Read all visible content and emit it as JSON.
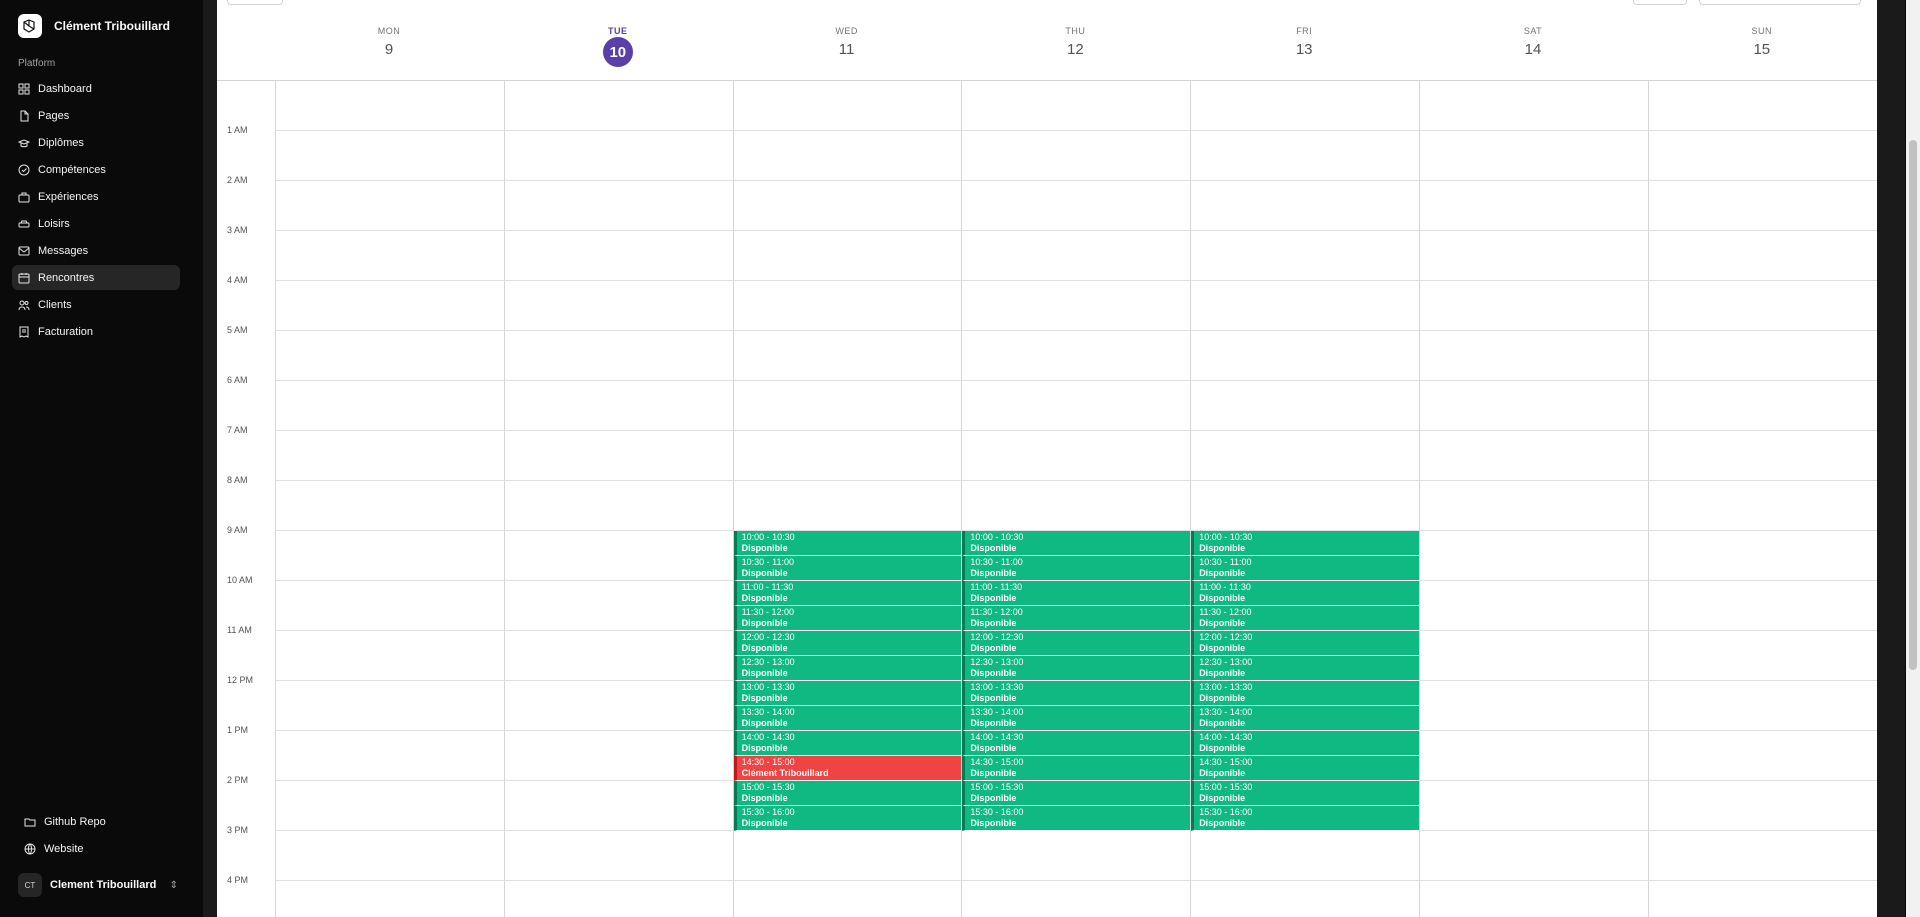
{
  "app": {
    "name": "Clément Tribouillard"
  },
  "sidebar": {
    "section_label": "Platform",
    "items": [
      {
        "label": "Dashboard",
        "icon": "dashboard-icon",
        "active": false
      },
      {
        "label": "Pages",
        "icon": "file-icon",
        "active": false
      },
      {
        "label": "Diplômes",
        "icon": "graduation-cap-icon",
        "active": false
      },
      {
        "label": "Compétences",
        "icon": "check-circle-icon",
        "active": false
      },
      {
        "label": "Expériences",
        "icon": "briefcase-icon",
        "active": false
      },
      {
        "label": "Loisirs",
        "icon": "car-icon",
        "active": false
      },
      {
        "label": "Messages",
        "icon": "mail-icon",
        "active": false
      },
      {
        "label": "Rencontres",
        "icon": "calendar-icon",
        "active": true
      },
      {
        "label": "Clients",
        "icon": "users-icon",
        "active": false
      },
      {
        "label": "Facturation",
        "icon": "receipt-icon",
        "active": false
      }
    ],
    "bottom_links": [
      {
        "label": "Github Repo",
        "icon": "folder-icon"
      },
      {
        "label": "Website",
        "icon": "globe-icon"
      }
    ],
    "user": {
      "initials": "CT",
      "name": "Clement Tribouillard"
    }
  },
  "calendar": {
    "days": [
      {
        "dow": "MON",
        "num": "9",
        "today": false
      },
      {
        "dow": "TUE",
        "num": "10",
        "today": true
      },
      {
        "dow": "WED",
        "num": "11",
        "today": false
      },
      {
        "dow": "THU",
        "num": "12",
        "today": false
      },
      {
        "dow": "FRI",
        "num": "13",
        "today": false
      },
      {
        "dow": "SAT",
        "num": "14",
        "today": false
      },
      {
        "dow": "SUN",
        "num": "15",
        "today": false
      }
    ],
    "hours": [
      "1 AM",
      "2 AM",
      "3 AM",
      "4 AM",
      "5 AM",
      "6 AM",
      "7 AM",
      "8 AM",
      "9 AM",
      "10 AM",
      "11 AM",
      "12 PM",
      "1 PM",
      "2 PM",
      "3 PM",
      "4 PM"
    ],
    "slot_times": [
      "10:00 - 10:30",
      "10:30 - 11:00",
      "11:00 - 11:30",
      "11:30 - 12:00",
      "12:00 - 12:30",
      "12:30 - 13:00",
      "13:00 - 13:30",
      "13:30 - 14:00",
      "14:00 - 14:30",
      "14:30 - 15:00",
      "15:00 - 15:30",
      "15:30 - 16:00"
    ],
    "available_label": "Disponible",
    "event_columns": [
      {
        "day": "WED",
        "booked": {
          "14:30 - 15:00": "Clément Tribouillard"
        }
      },
      {
        "day": "THU",
        "booked": {}
      },
      {
        "day": "FRI",
        "booked": {}
      }
    ],
    "colors": {
      "available": "#10b981",
      "booked": "#ef4444",
      "today": "#5b3fa8"
    }
  }
}
